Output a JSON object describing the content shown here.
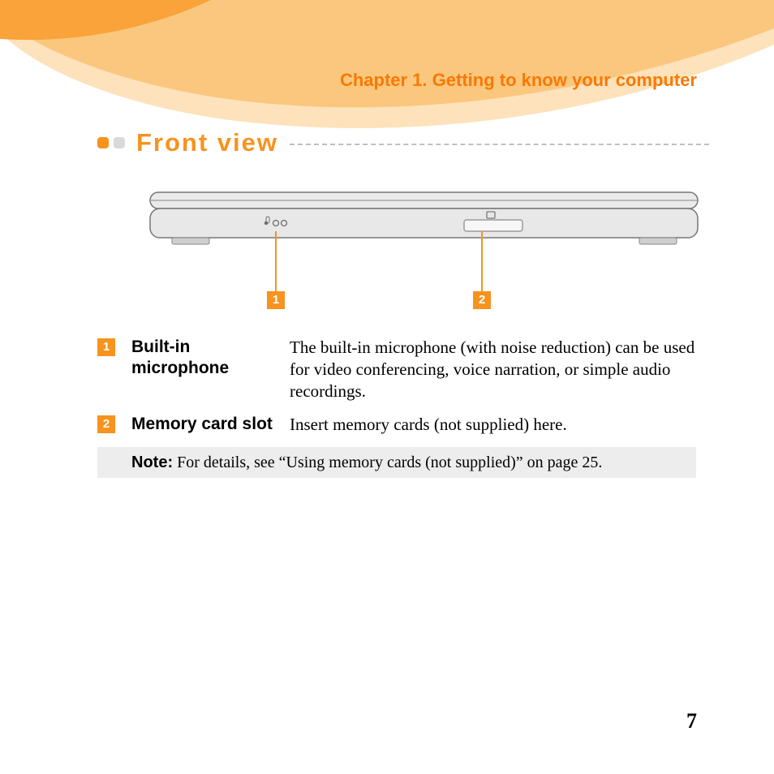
{
  "chapter_title": "Chapter 1. Getting to know your computer",
  "section_title": "Front view",
  "callouts": {
    "c1": "1",
    "c2": "2"
  },
  "items": [
    {
      "num": "1",
      "term": "Built-in microphone",
      "def": "The built-in microphone (with noise reduction) can be used for video conferencing, voice narration, or simple audio recordings."
    },
    {
      "num": "2",
      "term": "Memory card slot",
      "def": "Insert memory cards (not supplied) here."
    }
  ],
  "note": {
    "label": "Note:",
    "text": " For details, see “Using memory cards (not supplied)” on page 25."
  },
  "page_number": "7"
}
